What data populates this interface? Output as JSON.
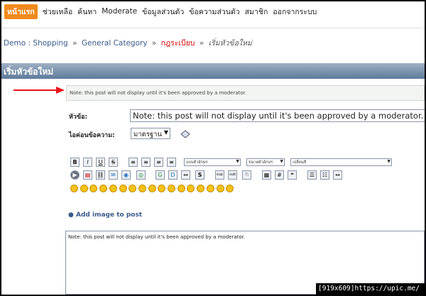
{
  "topnav": {
    "home": "หน้าแรก",
    "items": [
      "ช่วยเหลือ",
      "ค้นหา",
      "Moderate",
      "ข้อมูลส่วนตัว",
      "ข้อความส่วนตัว",
      "สมาชิก",
      "ออกจากระบบ"
    ]
  },
  "breadcrumb": {
    "items": [
      "Demo : Shopping",
      "General Category",
      "กฎระเบียบ"
    ],
    "separator": "»",
    "current": "เริ่มหัวข้อใหม่"
  },
  "header": {
    "title": "เริ่มหัวข้อใหม่"
  },
  "notice": {
    "text": "Note: this post will not display until it's been approved by a moderator."
  },
  "form": {
    "subject_label": "หัวข้อ:",
    "subject_value": "Note: this post will not display until it's been approved by a moderator.",
    "icon_label": "ไอค่อนข้อความ:",
    "icon_value": "มาตรฐาน"
  },
  "toolbar": {
    "font_face": "แบบตัวอักษร",
    "font_size": "ขนาดตัวอักษร",
    "font_color": "เปลี่ยนสี"
  },
  "smiley_count": 17,
  "add_image": "Add image to post",
  "editor": {
    "body": "Note: this post will not display until it's been approved by a moderator."
  },
  "watermark": "[919x609]https://upic.me/",
  "colors": {
    "accent": "#f08a1c",
    "link": "#3b5b8c",
    "rules": "#d40000",
    "arrow": "#e8141a"
  }
}
